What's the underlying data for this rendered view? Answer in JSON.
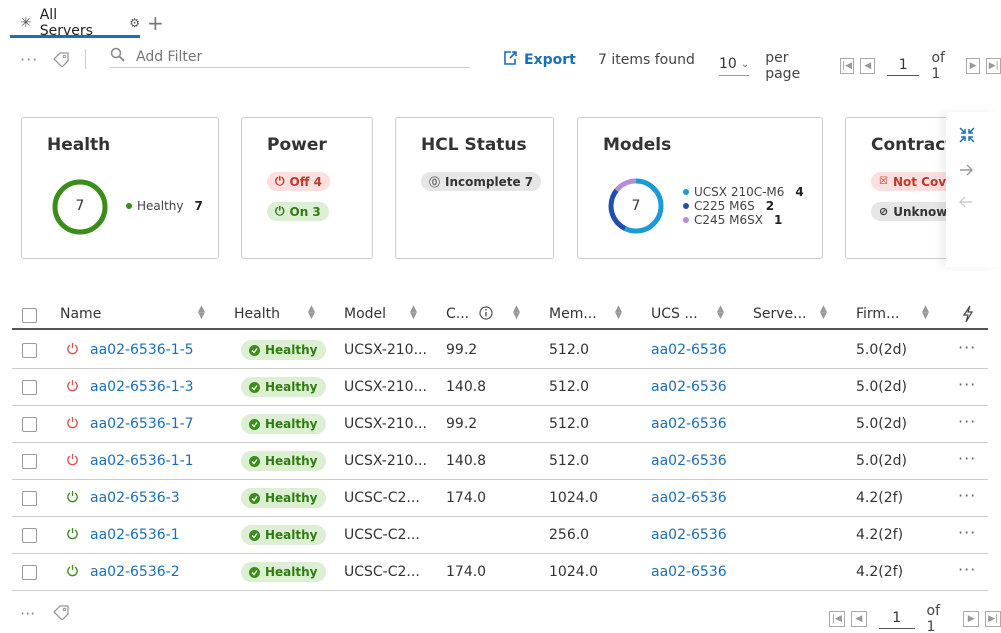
{
  "tab": {
    "label": "All Servers",
    "add": "+"
  },
  "toolbar": {
    "dots": "···",
    "filter_placeholder": "Add Filter",
    "export": "Export",
    "items_found": "7 items found",
    "per_page_value": "10",
    "per_page_label": "per page",
    "page": "1",
    "of": "of 1"
  },
  "cards": {
    "health": {
      "title": "Health",
      "total": "7",
      "legend": "Healthy",
      "count": "7"
    },
    "power": {
      "title": "Power",
      "off": "Off 4",
      "on": "On 3"
    },
    "hcl": {
      "title": "HCL Status",
      "incomplete": "Incomplete 7"
    },
    "models": {
      "title": "Models",
      "total": "7",
      "items": [
        {
          "name": "UCSX 210C-M6",
          "count": "4",
          "color": "#1c9ad6"
        },
        {
          "name": "C225 M6S",
          "count": "2",
          "color": "#1f4fb0"
        },
        {
          "name": "C245 M6SX",
          "count": "1",
          "color": "#b48fd4"
        }
      ]
    },
    "contracts": {
      "title": "Contract",
      "not_covered": "Not Cove",
      "unknown": "Unknowr"
    }
  },
  "table": {
    "headers": [
      "Name",
      "Health",
      "Model",
      "C...",
      "Mem...",
      "UCS ...",
      "Serve...",
      "Firm..."
    ],
    "rows": [
      {
        "name": "aa02-6536-1-5",
        "power": "off",
        "health": "Healthy",
        "model": "UCSX-210...",
        "cpu": "99.2",
        "mem": "512.0",
        "ucs": "aa02-6536",
        "server": "",
        "firmware": "5.0(2d)"
      },
      {
        "name": "aa02-6536-1-3",
        "power": "off",
        "health": "Healthy",
        "model": "UCSX-210...",
        "cpu": "140.8",
        "mem": "512.0",
        "ucs": "aa02-6536",
        "server": "",
        "firmware": "5.0(2d)"
      },
      {
        "name": "aa02-6536-1-7",
        "power": "off",
        "health": "Healthy",
        "model": "UCSX-210...",
        "cpu": "99.2",
        "mem": "512.0",
        "ucs": "aa02-6536",
        "server": "",
        "firmware": "5.0(2d)"
      },
      {
        "name": "aa02-6536-1-1",
        "power": "off",
        "health": "Healthy",
        "model": "UCSX-210...",
        "cpu": "140.8",
        "mem": "512.0",
        "ucs": "aa02-6536",
        "server": "",
        "firmware": "5.0(2d)"
      },
      {
        "name": "aa02-6536-3",
        "power": "on",
        "health": "Healthy",
        "model": "UCSC-C2...",
        "cpu": "174.0",
        "mem": "1024.0",
        "ucs": "aa02-6536",
        "server": "",
        "firmware": "4.2(2f)"
      },
      {
        "name": "aa02-6536-1",
        "power": "on",
        "health": "Healthy",
        "model": "UCSC-C2...",
        "cpu": "",
        "mem": "256.0",
        "ucs": "aa02-6536",
        "server": "",
        "firmware": "4.2(2f)"
      },
      {
        "name": "aa02-6536-2",
        "power": "on",
        "health": "Healthy",
        "model": "UCSC-C2...",
        "cpu": "174.0",
        "mem": "1024.0",
        "ucs": "aa02-6536",
        "server": "",
        "firmware": "4.2(2f)"
      }
    ],
    "row_menu": "···"
  },
  "colors": {
    "accent": "#1b6fb5",
    "healthy": "#3a8d18",
    "off": "#c0392b"
  }
}
